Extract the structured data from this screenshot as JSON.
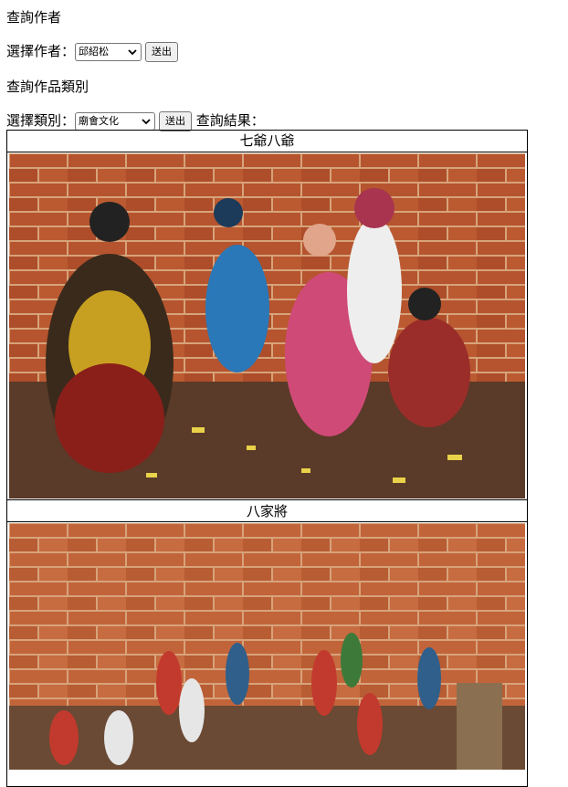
{
  "author_query": {
    "heading": "查詢作者",
    "select_label": "選擇作者：",
    "selected": "邱紹松",
    "submit_label": "送出"
  },
  "category_query": {
    "heading": "查詢作品類別",
    "select_label": "選擇類別：",
    "selected": "廟會文化",
    "submit_label": "送出",
    "result_label": "查詢結果："
  },
  "results": [
    {
      "title": "七爺八爺"
    },
    {
      "title": "八家將"
    }
  ],
  "colors": {
    "brick": "#b5542e",
    "mortar": "#d7a37a",
    "floor": "#5a3a28"
  }
}
